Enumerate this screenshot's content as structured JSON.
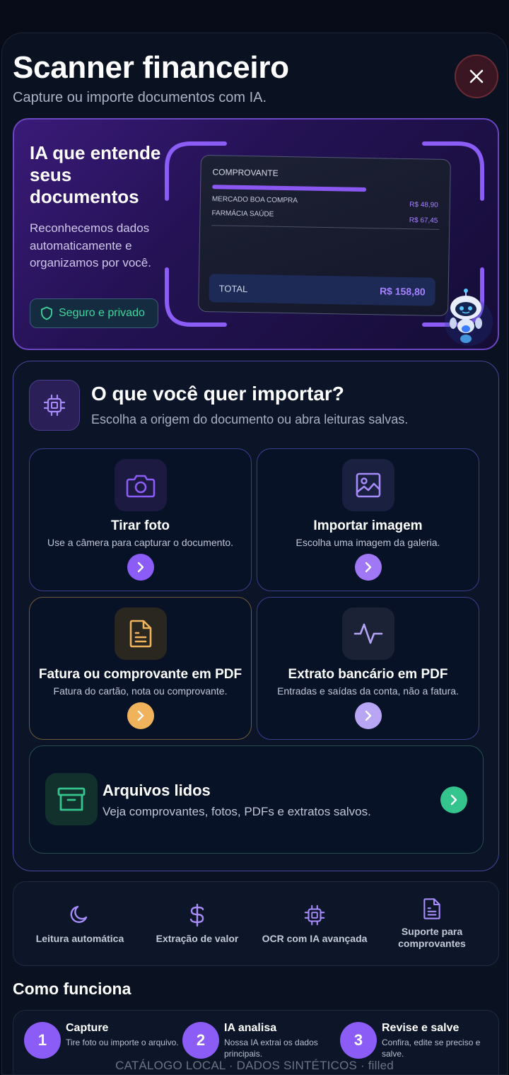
{
  "header": {
    "title": "Scanner financeiro",
    "subtitle": "Capture ou importe documentos com IA.",
    "close_icon": "close-icon"
  },
  "hero": {
    "title": "IA que entende seus documentos",
    "text": "Reconhecemos dados automaticamente e organizamos por você.",
    "badge": "Seguro e privado",
    "receipt": {
      "heading": "COMPROVANTE",
      "rows": [
        {
          "label": "MERCADO BOA COMPRA",
          "value": "R$ 48,90"
        },
        {
          "label": "FARMÁCIA SAÚDE",
          "value": "R$ 67,45"
        }
      ],
      "total_label": "TOTAL",
      "total_value": "R$ 158,80"
    }
  },
  "import": {
    "title": "O que você quer importar?",
    "subtitle": "Escolha a origem do documento ou abra leituras salvas.",
    "options": [
      {
        "title": "Tirar foto",
        "desc": "Use a câmera para capturar o documento.",
        "icon": "camera-icon"
      },
      {
        "title": "Importar imagem",
        "desc": "Escolha uma imagem da galeria.",
        "icon": "image-icon"
      },
      {
        "title": "Fatura ou comprovante em PDF",
        "desc": "Fatura do cartão, nota ou comprovante.",
        "icon": "file-text-icon"
      },
      {
        "title": "Extrato bancário em PDF",
        "desc": "Entradas e saídas da conta, não a fatura.",
        "icon": "activity-icon"
      }
    ],
    "files": {
      "title": "Arquivos lidos",
      "desc": "Veja comprovantes, fotos, PDFs e extratos salvos.",
      "icon": "archive-icon"
    }
  },
  "features": [
    {
      "label": "Leitura automática",
      "icon": "moon-icon"
    },
    {
      "label": "Extração de valor",
      "icon": "dollar-icon"
    },
    {
      "label": "OCR com IA avançada",
      "icon": "chip-icon"
    },
    {
      "label": "Suporte para comprovantes",
      "icon": "document-icon"
    }
  ],
  "how": {
    "title": "Como funciona",
    "steps": [
      {
        "num": "1",
        "title": "Capture",
        "desc": "Tire foto ou importe o arquivo."
      },
      {
        "num": "2",
        "title": "IA analisa",
        "desc": "Nossa IA extrai os dados principais."
      },
      {
        "num": "3",
        "title": "Revise e salve",
        "desc": "Confira, edite se preciso e salve."
      }
    ]
  },
  "footer": "CATÁLOGO LOCAL · DADOS SINTÉTICOS · filled",
  "colors": {
    "accent": "#8b5cf6",
    "pdf": "#f0b35b",
    "green": "#34c48d",
    "danger_bg": "#3a1622"
  }
}
